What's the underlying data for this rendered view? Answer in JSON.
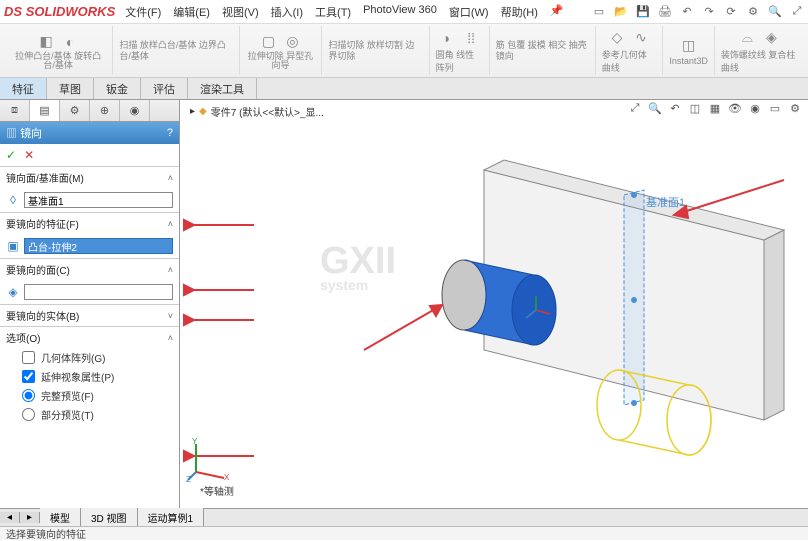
{
  "app": {
    "brand_ds": "DS",
    "brand_sw": "SOLIDWORKS"
  },
  "menu": {
    "file": "文件(F)",
    "edit": "编辑(E)",
    "view": "视图(V)",
    "insert": "插入(I)",
    "tools": "工具(T)",
    "photoview": "PhotoView 360",
    "window": "窗口(W)",
    "help": "帮助(H)"
  },
  "title_icons": [
    "pin",
    "new",
    "open",
    "save",
    "print",
    "undo",
    "redo",
    "gear",
    "rebuild",
    "options",
    "search",
    "expand"
  ],
  "ribbon": [
    {
      "icons": [
        "◧",
        "◨"
      ],
      "label": "拉伸凸台/基体 旋转凸台/基体",
      "extra": "扫描\n放样凸台/基体\n边界凸台/基体"
    },
    {
      "icons": [
        "▢",
        "▣"
      ],
      "label": "拉伸切除 异型孔向导",
      "extra": "扫描切除\n放样切割\n边界切除"
    },
    {
      "icons": [
        "◐"
      ],
      "label": "圆角 线性阵列",
      "extra": "筋 包覆\n拔模 相交\n抽壳 镜向"
    },
    {
      "icons": [
        "◇"
      ],
      "label": "参考几何体 曲线"
    },
    {
      "icons": [
        "◫"
      ],
      "label": "Instant3D"
    },
    {
      "icons": [
        "⌓",
        "◈"
      ],
      "label": "装饰螺纹线 复合柱曲线"
    }
  ],
  "tabs": {
    "feature": "特征",
    "sketch": "草图",
    "sheetmetal": "钣金",
    "evaluate": "评估",
    "render": "渲染工具"
  },
  "panel": {
    "title": "镜向",
    "ok_icon": "✓",
    "cancel_icon": "✕",
    "sections": {
      "mirror_plane": {
        "label": "镜向面/基准面(M)",
        "value": "基准面1"
      },
      "features": {
        "label": "要镜向的特征(F)",
        "value": "凸台-拉伸2"
      },
      "faces": {
        "label": "要镜向的面(C)",
        "value": ""
      },
      "bodies": {
        "label": "要镜向的实体(B)"
      },
      "options": {
        "label": "选项(O)",
        "geom_pattern": "几何体阵列(G)",
        "propagate_vis": "延伸视象属性(P)",
        "full_preview": "完整预览(F)",
        "partial_preview": "部分预览(T)"
      }
    }
  },
  "viewport": {
    "breadcrumb": "零件7 (默认<<默认>_显...",
    "plane_label": "基准面1",
    "trimetric": "*等轴测",
    "watermark_top": "GXII",
    "watermark_bottom": "system"
  },
  "bottom_tabs": {
    "model": "模型",
    "view3d": "3D 视图",
    "motion": "运动算例1"
  },
  "status": "选择要镜向的特征"
}
